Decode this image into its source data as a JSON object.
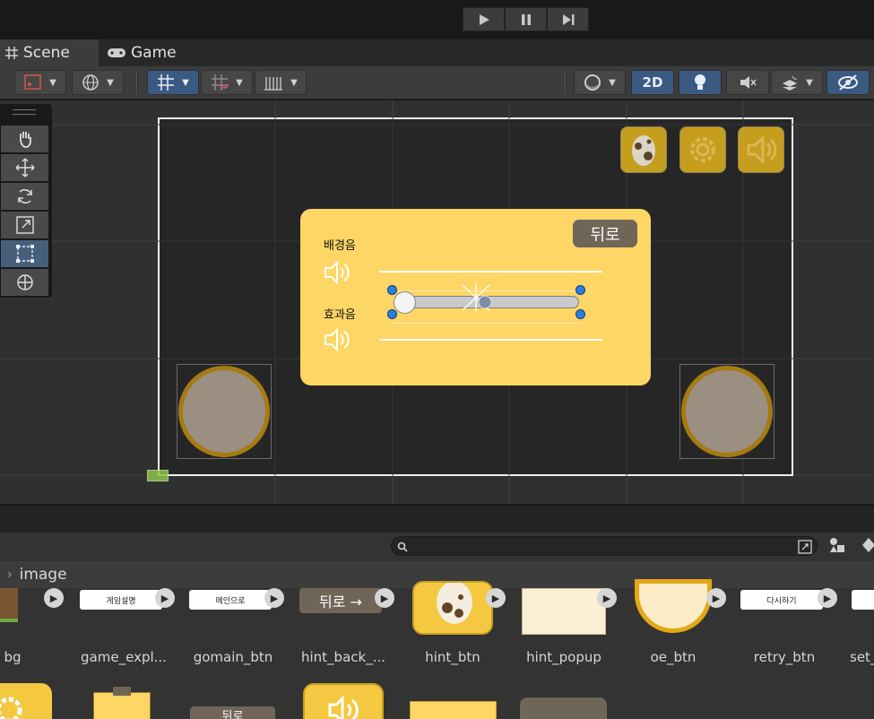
{
  "topbar": {
    "play": "play-icon",
    "pause": "pause-icon",
    "step": "step-icon"
  },
  "tabs": [
    {
      "label": "Scene",
      "icon": "grid-icon"
    },
    {
      "label": "Game",
      "icon": "gamepad-icon"
    }
  ],
  "toolbar": {
    "two_d_label": "2D"
  },
  "popup": {
    "back_label": "뒤로",
    "bgm_label": "배경음",
    "sfx_label": "효과음",
    "slider_value": 0.0,
    "colors": {
      "panel": "#fdd665",
      "button": "#6f6658"
    }
  },
  "breadcrumb": {
    "folder": "image"
  },
  "assets": [
    {
      "name": "bg",
      "thumb_text": ""
    },
    {
      "name": "game_expl...",
      "thumb_text": "게임설명"
    },
    {
      "name": "gomain_btn",
      "thumb_text": "메인으로"
    },
    {
      "name": "hint_back_...",
      "thumb_text": "뒤로 →"
    },
    {
      "name": "hint_btn",
      "thumb_text": ""
    },
    {
      "name": "hint_popup",
      "thumb_text": ""
    },
    {
      "name": "oe_btn",
      "thumb_text": ""
    },
    {
      "name": "retry_btn",
      "thumb_text": "다시하기"
    },
    {
      "name": "set_",
      "thumb_text": ""
    }
  ],
  "assets_row2": [
    {
      "thumb_text": ""
    },
    {
      "thumb_text": ""
    },
    {
      "thumb_text": "뒤로"
    },
    {
      "thumb_text": ""
    },
    {
      "thumb_text": ""
    },
    {
      "thumb_text": ""
    }
  ]
}
